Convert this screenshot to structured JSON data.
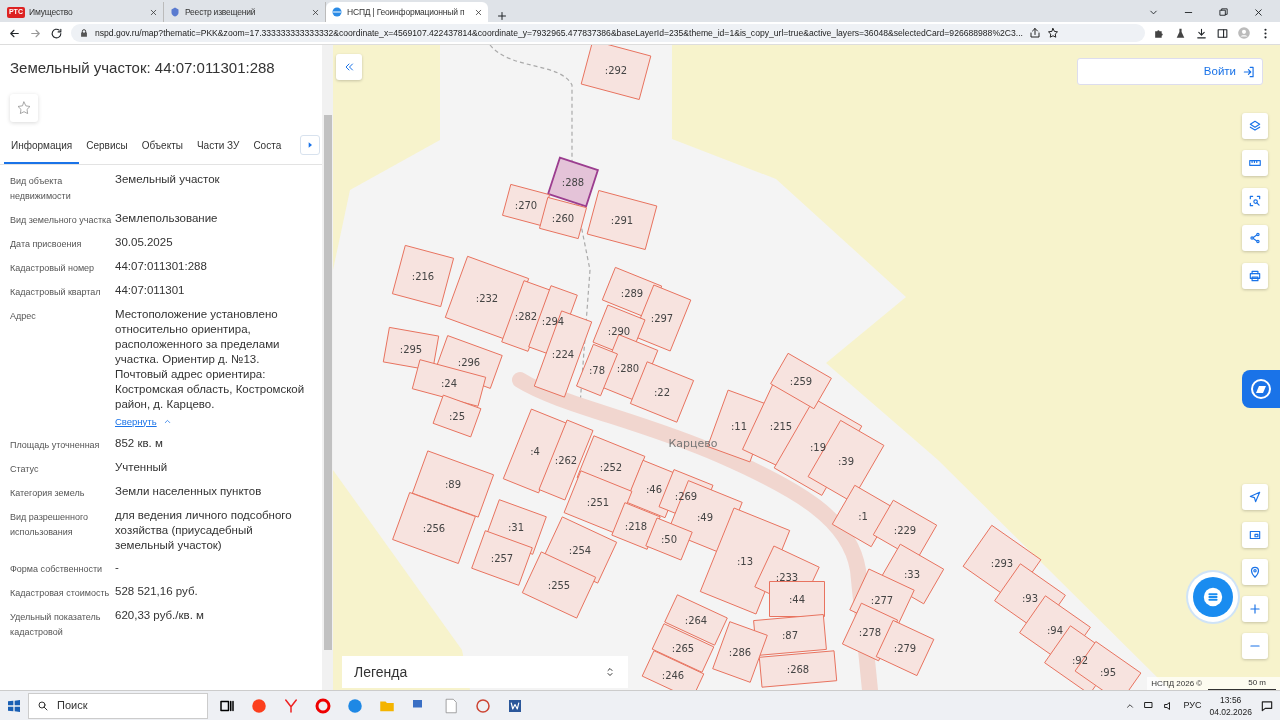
{
  "browser": {
    "tabs": [
      {
        "title": "Имущество",
        "selected": false,
        "kind": "rts",
        "badge": "РТС"
      },
      {
        "title": "Реестр извещений",
        "selected": false,
        "kind": "emblem"
      },
      {
        "title": "НСПД | Геоинформационный п",
        "selected": true,
        "kind": "nspd"
      }
    ],
    "url": "nspd.gov.ru/map?thematic=PKK&zoom=17.333333333333332&coordinate_x=4569107.422437814&coordinate_y=7932965.477837386&baseLayerId=235&theme_id=1&is_copy_url=true&active_layers=36048&selectedCard=926688988%2C3..."
  },
  "panel": {
    "title": "Земельный участок: 44:07:011301:288",
    "favorite": false,
    "tabs": [
      {
        "label": "Информация",
        "selected": true
      },
      {
        "label": "Сервисы",
        "selected": false
      },
      {
        "label": "Объекты",
        "selected": false
      },
      {
        "label": "Части ЗУ",
        "selected": false
      },
      {
        "label": "Соста",
        "selected": false
      }
    ],
    "fields": [
      {
        "label": "Вид объекта недвижимости",
        "value": "Земельный участок"
      },
      {
        "label": "Вид земельного участка",
        "value": "Землепользование"
      },
      {
        "label": "Дата присвоения",
        "value": "30.05.2025"
      },
      {
        "label": "Кадастровый номер",
        "value": "44:07:011301:288"
      },
      {
        "label": "Кадастровый квартал",
        "value": "44:07:011301"
      },
      {
        "label": "Адрес",
        "value": "Местоположение установлено относительно ориентира, расположенного за пределами участка. Ориентир д. №13. Почтовый адрес ориентира: Костромская область, Костромской район, д. Карцево.",
        "link": "Свернуть",
        "expanded": true
      },
      {
        "label": "Площадь уточненная",
        "value": "852 кв. м"
      },
      {
        "label": "Статус",
        "value": "Учтенный"
      },
      {
        "label": "Категория земель",
        "value": "Земли населенных пунктов"
      },
      {
        "label": "Вид разрешенного использования",
        "value": "для ведения личного подсобного хозяйства (приусадебный земельный участок)"
      },
      {
        "label": "Форма собственности",
        "value": "-"
      },
      {
        "label": "Кадастровая стоимость",
        "value": "528 521,16 руб."
      },
      {
        "label": "Удельный показатель кадастровой",
        "value": "620,33 руб./кв. м"
      }
    ]
  },
  "map": {
    "login": "Войти",
    "place_label": "Карцево",
    "legend": "Легенда",
    "attribution": "НСПД 2026 ©",
    "scale": "50 m",
    "parcels": [
      {
        "label": ":292",
        "selected": false
      },
      {
        "label": ":288",
        "selected": true
      },
      {
        "label": ":270",
        "selected": false
      },
      {
        "label": ":260",
        "selected": false
      },
      {
        "label": ":291",
        "selected": false
      },
      {
        "label": ":216",
        "selected": false
      },
      {
        "label": ":232",
        "selected": false
      },
      {
        "label": ":282",
        "selected": false
      },
      {
        "label": ":294",
        "selected": false
      },
      {
        "label": ":224",
        "selected": false
      },
      {
        "label": ":289",
        "selected": false
      },
      {
        "label": ":297",
        "selected": false
      },
      {
        "label": ":290",
        "selected": false
      },
      {
        "label": ":280",
        "selected": false
      },
      {
        "label": ":78",
        "selected": false
      },
      {
        "label": ":22",
        "selected": false
      },
      {
        "label": ":295",
        "selected": false
      },
      {
        "label": ":296",
        "selected": false
      },
      {
        "label": ":24",
        "selected": false
      },
      {
        "label": ":25",
        "selected": false
      },
      {
        "label": ":4",
        "selected": false
      },
      {
        "label": ":262",
        "selected": false
      },
      {
        "label": ":252",
        "selected": false
      },
      {
        "label": ":46",
        "selected": false
      },
      {
        "label": ":269",
        "selected": false
      },
      {
        "label": ":49",
        "selected": false
      },
      {
        "label": ":251",
        "selected": false
      },
      {
        "label": ":218",
        "selected": false
      },
      {
        "label": ":50",
        "selected": false
      },
      {
        "label": ":13",
        "selected": false
      },
      {
        "label": ":89",
        "selected": false
      },
      {
        "label": ":256",
        "selected": false
      },
      {
        "label": ":31",
        "selected": false
      },
      {
        "label": ":257",
        "selected": false
      },
      {
        "label": ":254",
        "selected": false
      },
      {
        "label": ":255",
        "selected": false
      },
      {
        "label": ":233",
        "selected": false
      },
      {
        "label": ":11",
        "selected": false
      },
      {
        "label": ":215",
        "selected": false
      },
      {
        "label": ":19",
        "selected": false
      },
      {
        "label": ":259",
        "selected": false
      },
      {
        "label": ":39",
        "selected": false
      },
      {
        "label": ":1",
        "selected": false
      },
      {
        "label": ":229",
        "selected": false
      },
      {
        "label": ":33",
        "selected": false
      },
      {
        "label": ":277",
        "selected": false
      },
      {
        "label": ":278",
        "selected": false
      },
      {
        "label": ":279",
        "selected": false
      },
      {
        "label": ":44",
        "selected": false
      },
      {
        "label": ":87",
        "selected": false
      },
      {
        "label": ":268",
        "selected": false
      },
      {
        "label": ":286",
        "selected": false
      },
      {
        "label": ":264",
        "selected": false
      },
      {
        "label": ":265",
        "selected": false
      },
      {
        "label": ":246",
        "selected": false
      },
      {
        "label": ":293",
        "selected": false
      },
      {
        "label": ":93",
        "selected": false
      },
      {
        "label": ":94",
        "selected": false
      },
      {
        "label": ":92",
        "selected": false
      },
      {
        "label": ":95",
        "selected": false
      }
    ]
  },
  "taskbar": {
    "search_placeholder": "Поиск",
    "language": "РУС",
    "time": "13:56",
    "date": "04.02.2026"
  }
}
